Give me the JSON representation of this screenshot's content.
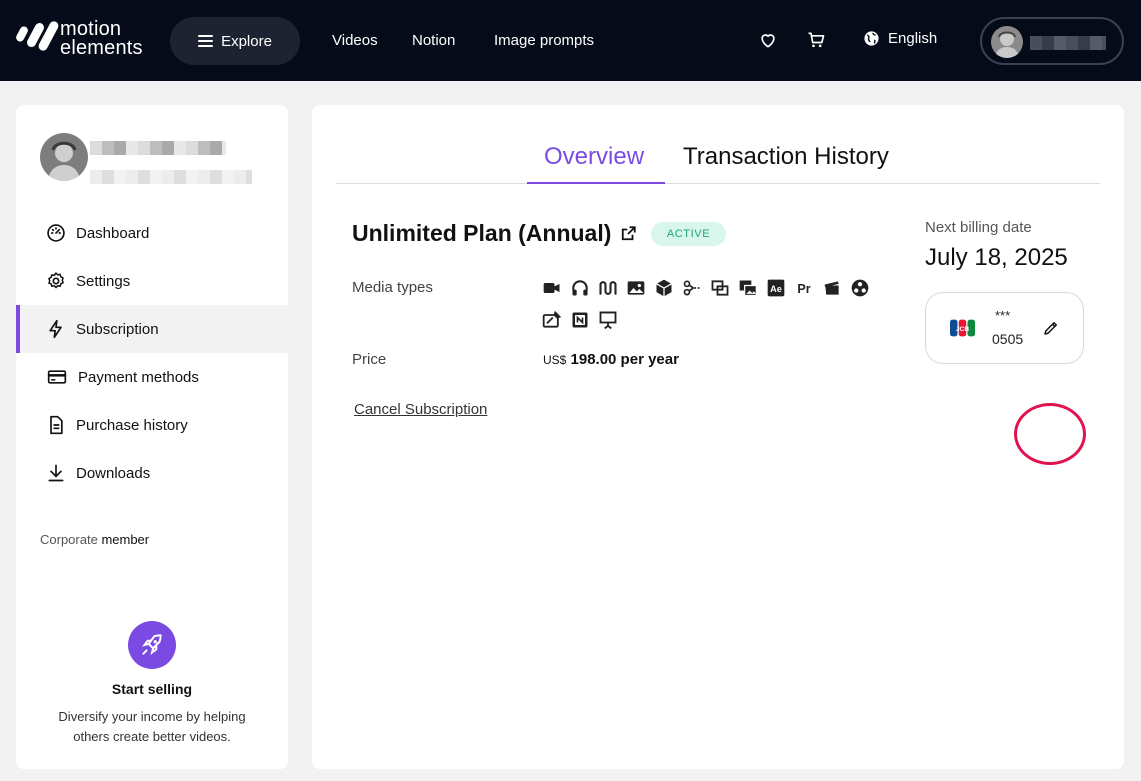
{
  "header": {
    "logo_line1": "motion",
    "logo_line2": "elements",
    "explore_label": "Explore",
    "nav_links": [
      "Videos",
      "Notion",
      "Image prompts"
    ],
    "language": "English"
  },
  "sidebar": {
    "items": [
      {
        "label": "Dashboard",
        "icon": "dashboard-icon"
      },
      {
        "label": "Settings",
        "icon": "gear-icon"
      },
      {
        "label": "Subscription",
        "icon": "lightning-icon",
        "active": true
      },
      {
        "label": "Payment methods",
        "icon": "credit-card-icon"
      },
      {
        "label": "Purchase history",
        "icon": "document-icon"
      },
      {
        "label": "Downloads",
        "icon": "download-icon"
      }
    ],
    "member_prefix": "Corporate",
    "member_suffix": "member",
    "start_selling_title": "Start selling",
    "start_selling_desc": "Diversify your income by helping others create better videos."
  },
  "tabs": {
    "overview": "Overview",
    "history": "Transaction History"
  },
  "plan": {
    "title": "Unlimited Plan (Annual)",
    "status": "ACTIVE",
    "media_label": "Media types",
    "price_label": "Price",
    "price_currency": "US$",
    "price_value": "198.00 per year",
    "cancel_label": "Cancel Subscription"
  },
  "billing": {
    "label": "Next billing date",
    "date": "July 18, 2025",
    "card_mask": "***",
    "card_last4": "0505",
    "card_brand": "JCB"
  },
  "colors": {
    "accent": "#7b4ae2",
    "topbar": "#050b18",
    "active_badge_bg": "#d8f6ec",
    "active_badge_text": "#21a47d",
    "highlight_ring": "#e0134f"
  }
}
